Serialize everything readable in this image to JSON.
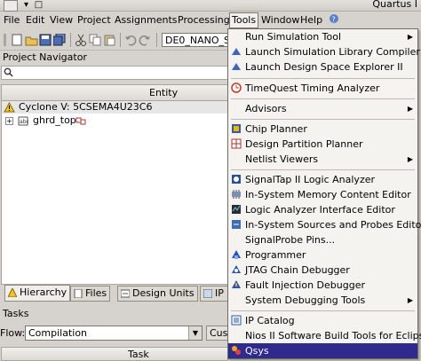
{
  "window": {
    "title": "Quartus I"
  },
  "menubar": {
    "items": [
      "File",
      "Edit",
      "View",
      "Project",
      "Assignments",
      "Processing",
      "Tools",
      "Window",
      "Help"
    ]
  },
  "toolbar": {
    "device_value": "DE0_NANO_SC"
  },
  "project_navigator": {
    "title": "Project Navigator",
    "column_header": "Entity",
    "device_row": "Cyclone V: 5CSEMA4U23C6",
    "top_entity": "ghrd_top",
    "tabs": [
      "Hierarchy",
      "Files",
      "Design Units",
      "IP"
    ]
  },
  "tasks": {
    "title": "Tasks",
    "flow_label": "Flow:",
    "flow_value": "Compilation",
    "customize_label": "Cust",
    "column_header": "Task"
  },
  "tools_menu": {
    "items": [
      {
        "label": "Run Simulation Tool",
        "submenu": true,
        "icon": "none"
      },
      {
        "label": "Launch Simulation Library Compiler",
        "icon": "simlib-icon"
      },
      {
        "label": "Launch Design Space Explorer II",
        "icon": "dse-icon"
      },
      {
        "label": "TimeQuest Timing Analyzer",
        "icon": "timequest-icon"
      },
      {
        "label": "Advisors",
        "submenu": true,
        "icon": "none"
      },
      {
        "label": "Chip Planner",
        "icon": "chip-planner-icon"
      },
      {
        "label": "Design Partition Planner",
        "icon": "partition-icon"
      },
      {
        "label": "Netlist Viewers",
        "submenu": true,
        "icon": "none"
      },
      {
        "label": "SignalTap II Logic Analyzer",
        "icon": "signaltap-icon"
      },
      {
        "label": "In-System Memory Content Editor",
        "icon": "memory-editor-icon"
      },
      {
        "label": "Logic Analyzer Interface Editor",
        "icon": "lai-icon"
      },
      {
        "label": "In-System Sources and Probes Editor",
        "icon": "probes-icon"
      },
      {
        "label": "SignalProbe Pins...",
        "icon": "none"
      },
      {
        "label": "Programmer",
        "icon": "programmer-icon"
      },
      {
        "label": "JTAG Chain Debugger",
        "icon": "jtag-icon"
      },
      {
        "label": "Fault Injection Debugger",
        "icon": "fault-icon"
      },
      {
        "label": "System Debugging Tools",
        "submenu": true,
        "icon": "none"
      },
      {
        "label": "IP Catalog",
        "icon": "ip-catalog-icon"
      },
      {
        "label": "Nios II Software Build Tools for Eclipse",
        "icon": "none"
      },
      {
        "label": "Qsys",
        "icon": "qsys-icon",
        "highlighted": true
      }
    ],
    "highlight_color": "#2f2b8c"
  }
}
